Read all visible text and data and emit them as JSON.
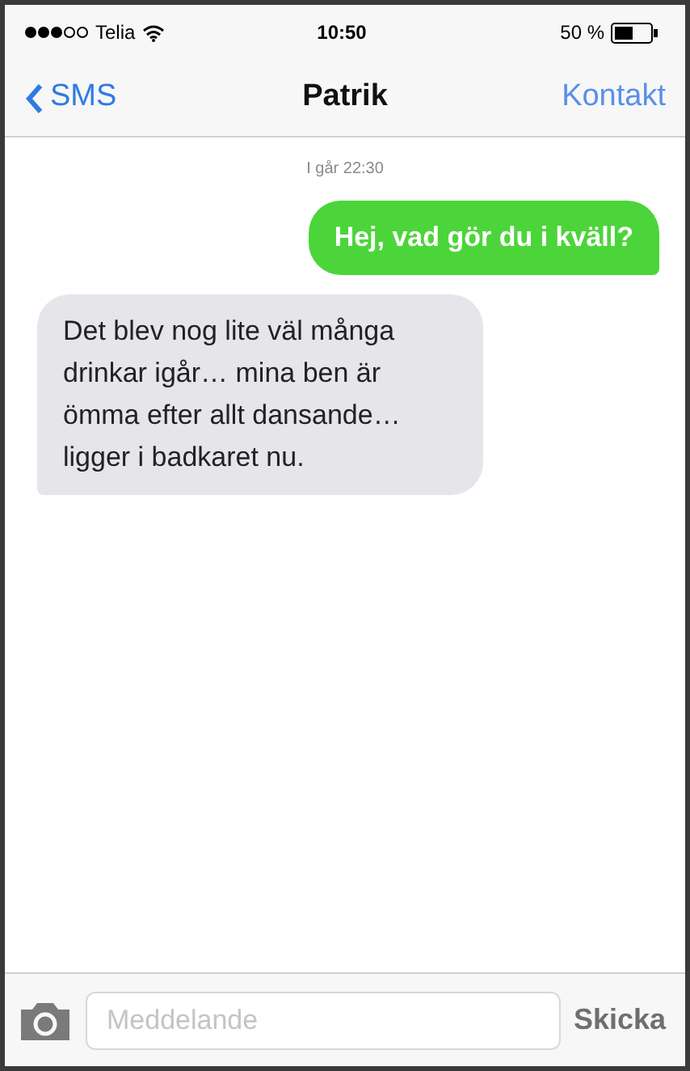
{
  "status_bar": {
    "carrier": "Telia",
    "time": "10:50",
    "battery": "50 %"
  },
  "nav": {
    "back": "SMS",
    "title": "Patrik",
    "action": "Kontakt"
  },
  "timestamp": "I går 22:30",
  "messages": [
    {
      "kind": "sent",
      "text": "Hej, vad gör du i kväll?"
    },
    {
      "kind": "received",
      "text": "Det blev nog lite väl många drinkar igår… mina ben är ömma efter allt dansande… ligger i badkaret nu."
    }
  ],
  "composer": {
    "placeholder": "Meddelande",
    "send": "Skicka"
  }
}
